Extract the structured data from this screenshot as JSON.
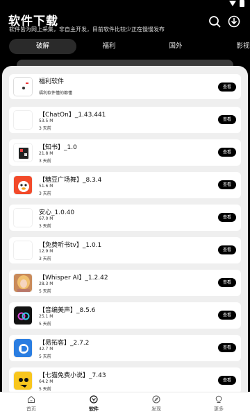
{
  "header": {
    "title": "软件下载",
    "subtitle": "软件皆为网上采集，非自主开发，目前软件比较少正在慢慢发布"
  },
  "tabs": [
    "破解",
    "福利",
    "国外",
    "影视"
  ],
  "featured": {
    "name": "福利软件",
    "desc": "福利软件懂的都懂",
    "button": "查看"
  },
  "apps": [
    {
      "name": "【ChatOn】_1.43.441",
      "size": "53.5 M",
      "date": "3 天前",
      "button": "查看"
    },
    {
      "name": "【知书】_1.0",
      "size": "21.8 M",
      "date": "3 天前",
      "button": "查看"
    },
    {
      "name": "【糖豆广场舞】_8.3.4",
      "size": "51.6 M",
      "date": "3 天前",
      "button": "查看"
    },
    {
      "name": "安心_1.0.40",
      "size": "67.0 M",
      "date": "3 天前",
      "button": "查看"
    },
    {
      "name": "【免费听书tv】_1.0.1",
      "size": "12.9 M",
      "date": "3 天前",
      "button": "查看"
    },
    {
      "name": "【Whisper AI】_1.2.42",
      "size": "28.3 M",
      "date": "5 天前",
      "button": "查看"
    },
    {
      "name": "【音编美声】_8.5.6",
      "size": "25.1 M",
      "date": "5 天前",
      "button": "查看"
    },
    {
      "name": "【易拓客】_2.7.2",
      "size": "42.7 M",
      "date": "5 天前",
      "button": "查看"
    },
    {
      "name": "【七猫免费小说】_7.43",
      "size": "64.2 M",
      "date": "5 天前",
      "button": "查看"
    }
  ],
  "nav": [
    "首页",
    "软件",
    "发现",
    "更多"
  ]
}
